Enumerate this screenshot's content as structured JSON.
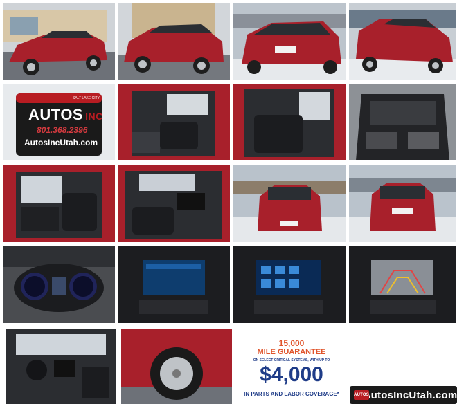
{
  "gallery": {
    "logo_sign": {
      "small_text": "SALT LAKE CITY",
      "brand": "AUTOS",
      "brand_suffix": "INC",
      "phone": "801.368.2396",
      "url": "AutosIncUtah.com"
    },
    "guarantee": {
      "amount_miles": "15,000",
      "headline": "MILE GUARANTEE",
      "subline": "ON SELECT CRITICAL SYSTEMS, WITH UP TO",
      "amount": "$4,000",
      "coverage": "IN PARTS AND LABOR COVERAGE*"
    },
    "footer_banner": {
      "text": "AutosIncUtah.com",
      "mini_logo": "AUTOS"
    }
  },
  "colors": {
    "car_red": "#a8202b",
    "asphalt": "#6d7178",
    "snow": "#e9ecef",
    "sign_red": "#b81c22",
    "guarantee_blue": "#1f3c88"
  }
}
